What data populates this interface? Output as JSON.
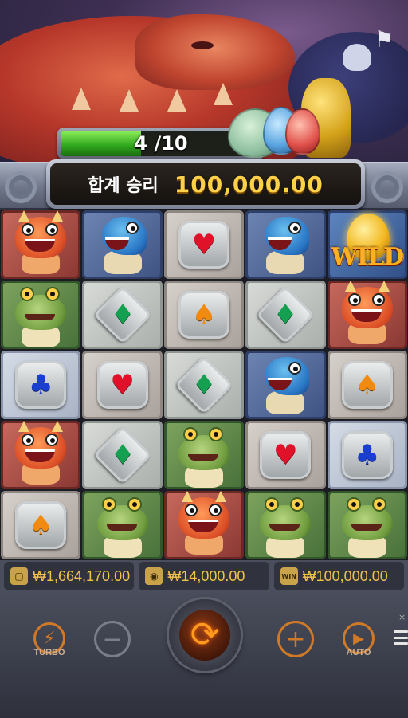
{
  "header": {
    "progress_text": "4 /10",
    "progress_fraction": 0.4,
    "trophy_icon": "trophy-icon"
  },
  "total_win": {
    "label": "합계 승리",
    "value": "100,000.00"
  },
  "reels": {
    "rows": [
      [
        "red-dragon",
        "blue-dragon",
        "heart",
        "blue-dragon",
        "wild"
      ],
      [
        "frog",
        "diamond",
        "spade",
        "diamond",
        "red-dragon"
      ],
      [
        "club",
        "heart",
        "diamond",
        "blue-dragon",
        "spade"
      ],
      [
        "red-dragon",
        "diamond",
        "frog",
        "heart",
        "club"
      ],
      [
        "spade",
        "frog",
        "red-dragon",
        "frog",
        "frog"
      ]
    ],
    "wild_text": "WILD"
  },
  "info_bar": {
    "balance": "₩1,664,170.00",
    "bet": "₩14,000.00",
    "win": "₩100,000.00",
    "win_icon_text": "WIN"
  },
  "controls": {
    "turbo_label": "TURBO",
    "auto_label": "AUTO",
    "minus_symbol": "−",
    "plus_symbol": "+",
    "spin_symbol": "⟳"
  },
  "colors": {
    "accent_orange": "#d07a28",
    "gold_text": "#ffd04a",
    "progress_green": "#2fa51c"
  }
}
